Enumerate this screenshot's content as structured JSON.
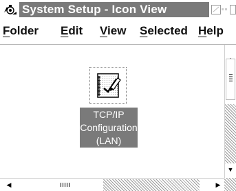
{
  "window": {
    "title": "System Setup - Icon View",
    "icon": "system-setup-icon"
  },
  "title_buttons": [
    {
      "name": "minimize-button",
      "icon": "minimize-icon"
    },
    {
      "name": "restore-button",
      "icon": "restore-icon"
    },
    {
      "name": "maximize-button",
      "icon": "maximize-icon"
    }
  ],
  "menu": {
    "folder": {
      "mnemonic": "F",
      "rest": "older"
    },
    "edit": {
      "mnemonic": "E",
      "rest": "dit"
    },
    "view": {
      "mnemonic": "V",
      "rest": "iew"
    },
    "selected": {
      "mnemonic": "S",
      "rest": "elected"
    },
    "help": {
      "mnemonic": "H",
      "rest": "elp"
    }
  },
  "objects": [
    {
      "icon": "tcpip-notebook-icon",
      "label_lines": [
        "TCP/IP",
        "Configuration",
        "(LAN)"
      ],
      "selected": true
    }
  ],
  "scrollbars": {
    "vertical": {
      "up_icon": "arrow-up-icon",
      "down_icon": "arrow-down-icon"
    },
    "horizontal": {
      "left_icon": "arrow-left-icon",
      "right_icon": "arrow-right-icon"
    }
  },
  "colors": {
    "title_active": "#7a7a7a",
    "selection": "#7a7a7a",
    "background": "#ffffff"
  }
}
